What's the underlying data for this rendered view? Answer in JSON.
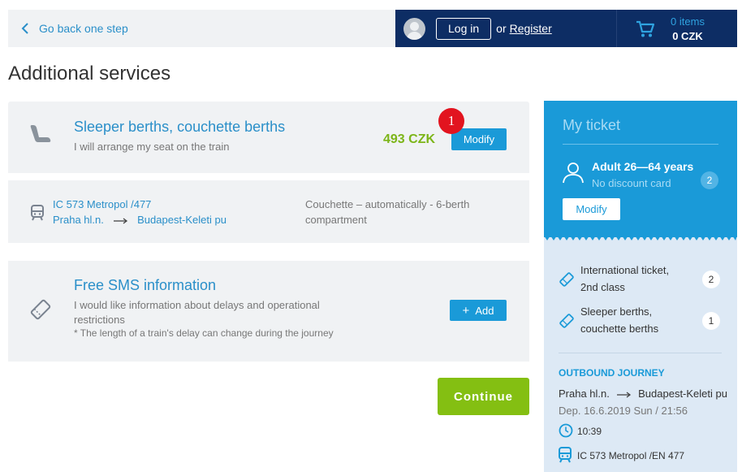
{
  "header": {
    "back_label": "Go back one step",
    "login_label": "Log in",
    "or_text": "or",
    "register_label": "Register",
    "cart_count": "0 items",
    "cart_total": "0 CZK"
  },
  "page_title": "Additional services",
  "sleeper": {
    "title": "Sleeper berths, couchette berths",
    "subtitle": "I will arrange my seat on the train",
    "price": "493 CZK",
    "modify_label": "Modify",
    "badge": "1",
    "train": "IC 573 Metropol /477",
    "from": "Praha hl.n.",
    "to": "Budapest-Keleti pu",
    "compartment": "Couchette – automatically - 6-berth compartment"
  },
  "sms": {
    "title": "Free SMS information",
    "subtitle": "I would like information about delays and operational restrictions",
    "note": "* The length of a train's delay can change during the journey",
    "add_label": "Add"
  },
  "continue_label": "Continue",
  "sidebar": {
    "title": "My ticket",
    "passenger": {
      "type": "Adult 26—64 years",
      "discount": "No discount card",
      "count": "2"
    },
    "modify_label": "Modify",
    "items": [
      {
        "line1": "International ticket,",
        "line2": "2nd class",
        "count": "2"
      },
      {
        "line1": "Sleeper berths,",
        "line2": "couchette berths",
        "count": "1"
      }
    ],
    "journey": {
      "heading": "OUTBOUND JOURNEY",
      "from": "Praha hl.n.",
      "to": "Budapest-Keleti pu",
      "departure": "Dep. 16.6.2019 Sun / 21:56",
      "time": "10:39",
      "train": "IC 573 Metropol /EN 477"
    }
  },
  "colors": {
    "navy": "#0d2d64",
    "blue": "#1a9ad8",
    "green": "#84bf12",
    "price_green": "#7cb518",
    "badge_red": "#e2141f"
  }
}
